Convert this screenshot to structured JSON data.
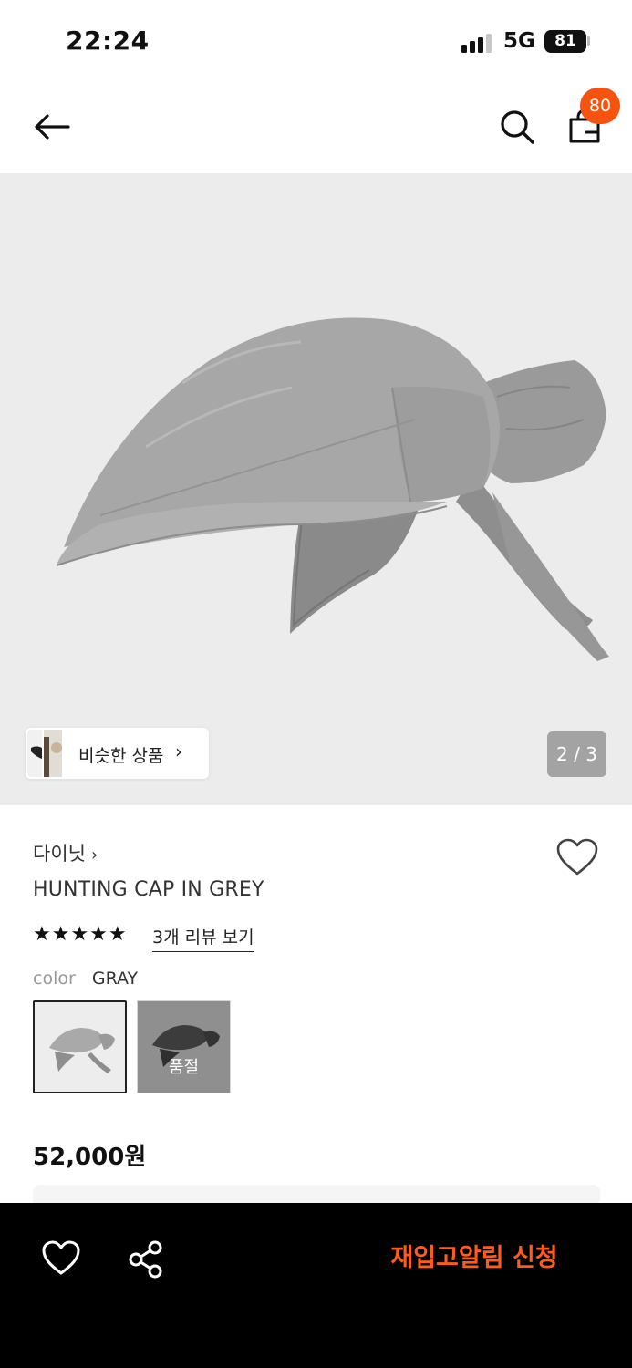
{
  "status_bar": {
    "time": "22:24",
    "network": "5G",
    "battery": "81"
  },
  "nav": {
    "back_icon": "arrow-left-icon",
    "search_icon": "search-icon",
    "cart_icon": "shopping-bag-icon",
    "cart_count": "80"
  },
  "gallery": {
    "similar_label": "비슷한 상품",
    "similar_chevron": "›",
    "page_indicator": "2 / 3"
  },
  "product": {
    "brand": "다이닛",
    "brand_chevron": "›",
    "name": "HUNTING CAP IN GREY",
    "rating_stars": "★★★★★",
    "review_link": "3개 리뷰 보기",
    "option_label": "color",
    "option_value": "GRAY",
    "swatches": [
      {
        "selected": true
      },
      {
        "sold_out_label": "품절"
      }
    ],
    "price": "52,000원"
  },
  "action_bar": {
    "wish_icon": "heart-icon",
    "share_icon": "share-icon",
    "restock_label": "재입고알림 신청"
  },
  "colors": {
    "accent": "#f5530f",
    "restock_text": "#ff5b1a",
    "hero_bg": "#ececec",
    "bar_bg": "#000000"
  }
}
